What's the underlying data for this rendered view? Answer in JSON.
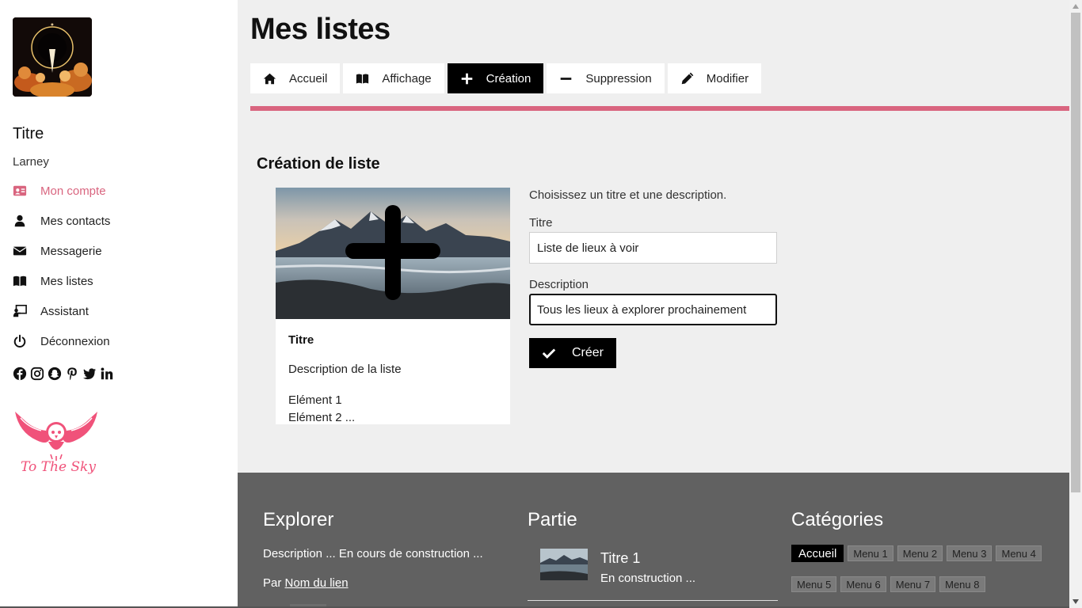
{
  "sidebar": {
    "title": "Titre",
    "user": "Larney",
    "items": [
      {
        "label": "Mon compte",
        "icon": "id-card-icon",
        "active": true
      },
      {
        "label": "Mes contacts",
        "icon": "user-icon"
      },
      {
        "label": "Messagerie",
        "icon": "envelope-icon"
      },
      {
        "label": "Mes listes",
        "icon": "book-icon"
      },
      {
        "label": "Assistant",
        "icon": "chalkboard-teacher-icon"
      },
      {
        "label": "Déconnexion",
        "icon": "power-icon"
      }
    ],
    "socials": [
      "facebook-icon",
      "instagram-icon",
      "snapchat-icon",
      "pinterest-icon",
      "twitter-icon",
      "linkedin-icon"
    ],
    "logo_text": "To The Sky"
  },
  "header": {
    "title": "Mes listes",
    "tabs": [
      {
        "label": "Accueil",
        "icon": "home-icon"
      },
      {
        "label": "Affichage",
        "icon": "book-icon"
      },
      {
        "label": "Création",
        "icon": "plus-icon",
        "active": true
      },
      {
        "label": "Suppression",
        "icon": "minus-icon"
      },
      {
        "label": "Modifier",
        "icon": "pencil-icon"
      }
    ]
  },
  "main": {
    "section_title": "Création de liste",
    "card": {
      "title": "Titre",
      "description": "Description de la liste",
      "elements": [
        "Elément 1",
        "Elément 2 ..."
      ]
    },
    "form": {
      "help": "Choisissez un titre et une description.",
      "title_label": "Titre",
      "title_value": "Liste de lieux à voir",
      "description_label": "Description",
      "description_value": "Tous les lieux à explorer prochainement",
      "submit_label": "Créer"
    }
  },
  "footer": {
    "explorer": {
      "title": "Explorer",
      "description": "Description ... En cours de construction ...",
      "by_prefix": "Par",
      "by_link": "Nom du lien"
    },
    "partie": {
      "title": "Partie",
      "post_title": "Titre 1",
      "post_subtitle": "En construction ..."
    },
    "categories": {
      "title": "Catégories",
      "items": [
        "Accueil",
        "Menu 1",
        "Menu 2",
        "Menu 3",
        "Menu 4",
        "Menu 5",
        "Menu 6",
        "Menu 7",
        "Menu 8"
      ]
    }
  },
  "colors": {
    "accent": "#d9657f",
    "footer_bg": "#616161",
    "active_tab": "#000000"
  }
}
